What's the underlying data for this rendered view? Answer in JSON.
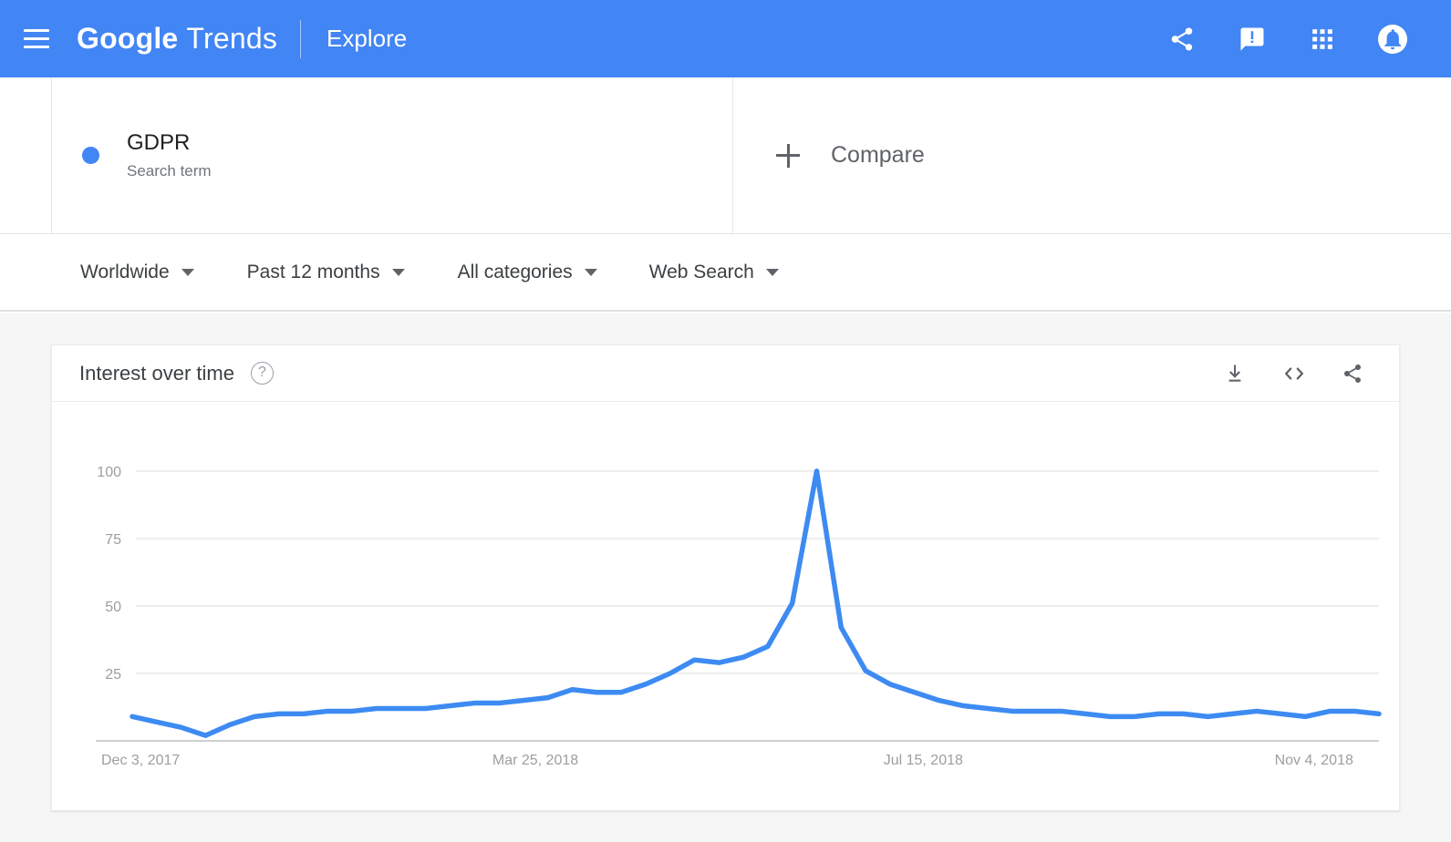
{
  "appbar": {
    "menu_icon": "hamburger-menu-icon",
    "brand_primary": "Google",
    "brand_secondary": "Trends",
    "nav_label": "Explore",
    "icons": [
      {
        "name": "share-icon",
        "label": "Share"
      },
      {
        "name": "feedback-icon",
        "label": "Send feedback"
      },
      {
        "name": "apps-grid-icon",
        "label": "Google apps"
      },
      {
        "name": "notifications-bell-icon",
        "label": "Notifications"
      }
    ],
    "background_color": "#4285f4"
  },
  "query": {
    "term_label": "GDPR",
    "term_type": "Search term",
    "term_color": "#4285f4",
    "compare_label": "Compare",
    "compare_icon": "plus-icon"
  },
  "filters": [
    {
      "label": "Worldwide"
    },
    {
      "label": "Past 12 months"
    },
    {
      "label": "All categories"
    },
    {
      "label": "Web Search"
    }
  ],
  "card": {
    "title": "Interest over time",
    "help_glyph": "?",
    "actions": [
      {
        "name": "download-icon",
        "label": "Download CSV"
      },
      {
        "name": "embed-code-icon",
        "label": "Embed"
      },
      {
        "name": "share-icon",
        "label": "Share"
      }
    ]
  },
  "chart_data": {
    "type": "line",
    "title": "Interest over time",
    "xlabel": "",
    "ylabel": "",
    "ylim": [
      0,
      100
    ],
    "xlim": [
      "Dec 3, 2017",
      "Nov 25, 2018"
    ],
    "grid": true,
    "legend": false,
    "y_ticks": [
      100,
      75,
      50,
      25
    ],
    "x_ticks": [
      "Dec 3, 2017",
      "Mar 25, 2018",
      "Jul 15, 2018",
      "Nov 4, 2018"
    ],
    "series": [
      {
        "name": "GDPR",
        "color": "#3d8bf2",
        "x": [
          "Dec 3, 2017",
          "Dec 10, 2017",
          "Dec 17, 2017",
          "Dec 24, 2017",
          "Dec 31, 2017",
          "Jan 7, 2018",
          "Jan 14, 2018",
          "Jan 21, 2018",
          "Jan 28, 2018",
          "Feb 4, 2018",
          "Feb 11, 2018",
          "Feb 18, 2018",
          "Feb 25, 2018",
          "Mar 4, 2018",
          "Mar 11, 2018",
          "Mar 18, 2018",
          "Mar 25, 2018",
          "Apr 1, 2018",
          "Apr 8, 2018",
          "Apr 15, 2018",
          "Apr 22, 2018",
          "Apr 29, 2018",
          "May 6, 2018",
          "May 13, 2018",
          "May 20, 2018",
          "May 27, 2018",
          "Jun 3, 2018",
          "Jun 10, 2018",
          "Jun 17, 2018",
          "Jun 24, 2018",
          "Jul 1, 2018",
          "Jul 8, 2018",
          "Jul 15, 2018",
          "Jul 22, 2018",
          "Jul 29, 2018",
          "Aug 5, 2018",
          "Aug 12, 2018",
          "Aug 19, 2018",
          "Aug 26, 2018",
          "Sep 2, 2018",
          "Sep 9, 2018",
          "Sep 16, 2018",
          "Sep 23, 2018",
          "Sep 30, 2018",
          "Oct 7, 2018",
          "Oct 14, 2018",
          "Oct 21, 2018",
          "Oct 28, 2018",
          "Nov 4, 2018",
          "Nov 11, 2018",
          "Nov 18, 2018",
          "Nov 25, 2018"
        ],
        "values": [
          9,
          7,
          5,
          2,
          6,
          9,
          10,
          10,
          11,
          11,
          12,
          12,
          12,
          13,
          14,
          14,
          15,
          16,
          19,
          18,
          18,
          21,
          25,
          30,
          29,
          31,
          35,
          51,
          100,
          42,
          26,
          21,
          18,
          15,
          13,
          12,
          11,
          11,
          11,
          10,
          9,
          9,
          10,
          10,
          9,
          10,
          11,
          10,
          9,
          11,
          11,
          10
        ]
      }
    ]
  }
}
